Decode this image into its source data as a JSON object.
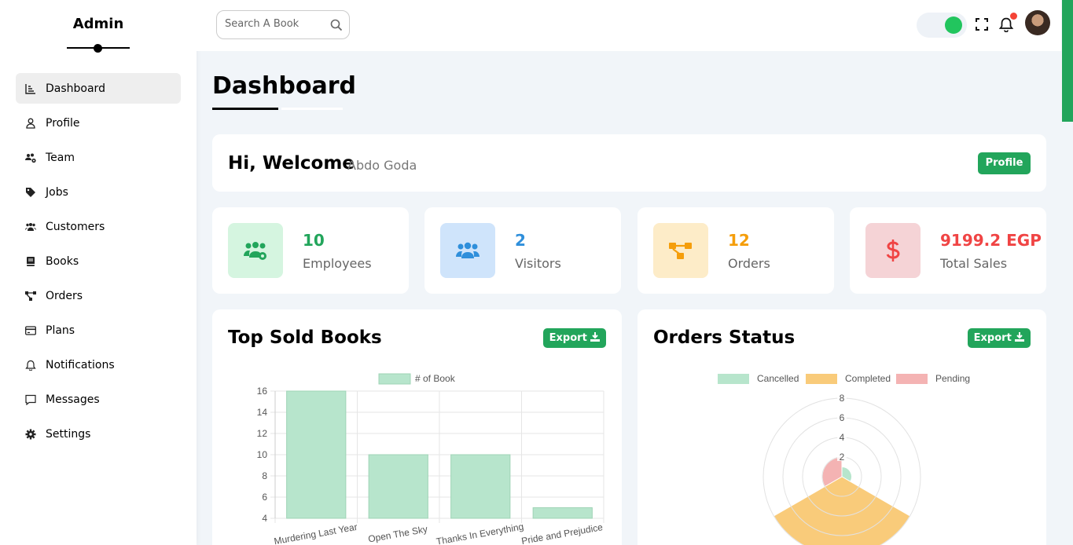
{
  "sidebar": {
    "brand": "Admin",
    "items": [
      {
        "label": "Dashboard",
        "icon": "chart-icon",
        "active": true
      },
      {
        "label": "Profile",
        "icon": "user-icon"
      },
      {
        "label": "Team",
        "icon": "team-icon"
      },
      {
        "label": "Jobs",
        "icon": "tags-icon"
      },
      {
        "label": "Customers",
        "icon": "users-icon"
      },
      {
        "label": "Books",
        "icon": "book-icon"
      },
      {
        "label": "Orders",
        "icon": "diagram-icon"
      },
      {
        "label": "Plans",
        "icon": "credit-card-icon"
      },
      {
        "label": "Notifications",
        "icon": "bell-icon"
      },
      {
        "label": "Messages",
        "icon": "message-icon"
      },
      {
        "label": "Settings",
        "icon": "gear-icon"
      }
    ]
  },
  "header": {
    "search_placeholder": "Search A Book",
    "toggle_on": true,
    "notification_dot": true
  },
  "main": {
    "title": "Dashboard",
    "welcome": {
      "greeting": "Hi, Welcome",
      "name": "Abdo Goda",
      "profile_button": "Profile"
    },
    "stats": [
      {
        "value": "10",
        "label": "Employees",
        "color": "#22a55b",
        "bg": "#d5f5e0",
        "icon": "team-gear-icon"
      },
      {
        "value": "2",
        "label": "Visitors",
        "color": "#2f8fdb",
        "bg": "#cfe4fb",
        "icon": "users-icon"
      },
      {
        "value": "12",
        "label": "Orders",
        "color": "#f59e0b",
        "bg": "#fdecc8",
        "icon": "diagram-icon"
      },
      {
        "value": "9199.2 EGP",
        "label": "Total Sales",
        "color": "#f04444",
        "bg": "#f5d3d6",
        "icon": "dollar-icon"
      }
    ],
    "top_books": {
      "title": "Top Sold Books",
      "export_label": "Export"
    },
    "orders_status": {
      "title": "Orders Status",
      "export_label": "Export"
    }
  },
  "chart_data": [
    {
      "type": "bar",
      "legend": [
        "# of Book"
      ],
      "categories": [
        "Murdering Last Year",
        "Open The Sky",
        "Thanks In Everything",
        "Pride and Prejudice"
      ],
      "values": [
        16,
        10,
        10,
        5
      ],
      "ylim": [
        4,
        16
      ],
      "yticks": [
        "16",
        "14",
        "12",
        "10",
        "8",
        "6",
        "4"
      ],
      "color": "#b7e5cc"
    },
    {
      "type": "polarArea",
      "legend": [
        "Cancelled",
        "Completed",
        "Pending"
      ],
      "values": [
        1,
        8,
        2
      ],
      "colors": [
        "#b7e5cc",
        "#f9cb7a",
        "#f4b3b3"
      ],
      "rticks": [
        "8",
        "6",
        "4",
        "2"
      ],
      "rmax": 8
    }
  ]
}
